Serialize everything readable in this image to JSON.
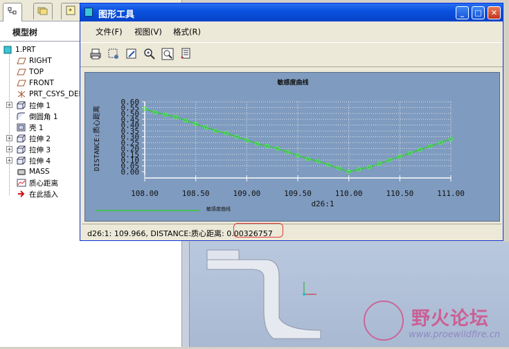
{
  "model_tree": {
    "title": "模型树",
    "items": [
      {
        "label": "1.PRT"
      },
      {
        "label": "RIGHT"
      },
      {
        "label": "TOP"
      },
      {
        "label": "FRONT"
      },
      {
        "label": "PRT_CSYS_DEF"
      },
      {
        "label": "拉伸 1"
      },
      {
        "label": "倒圆角 1"
      },
      {
        "label": "壳 1"
      },
      {
        "label": "拉伸 2"
      },
      {
        "label": "拉伸 3"
      },
      {
        "label": "拉伸 4"
      },
      {
        "label": "MASS"
      },
      {
        "label": "质心距离"
      },
      {
        "label": "在此插入"
      }
    ]
  },
  "window": {
    "title": "图形工具",
    "menu": [
      "文件(F)",
      "视图(V)",
      "格式(R)"
    ],
    "status_text": "d26:1: 109.966, DISTANCE:质心距离: 0.00326757"
  },
  "watermark": {
    "title": "野火论坛",
    "url": "www.proewildfire.cn"
  },
  "colors": {
    "titlebar": "#0a52e0",
    "plot_bg": "#7f9bbf",
    "series": "#33cc33",
    "highlight": "#e23c3c"
  },
  "chart_data": {
    "type": "line",
    "title": "敏感度曲线",
    "xlabel": "d26:1",
    "ylabel": "DISTANCE:质心距离",
    "xlim": [
      108.0,
      111.0
    ],
    "ylim": [
      0.0,
      0.6
    ],
    "xticks": [
      "108.00",
      "108.50",
      "109.00",
      "109.50",
      "110.00",
      "110.50",
      "111.00"
    ],
    "yticks": [
      "0.00",
      "0.05",
      "0.10",
      "0.15",
      "0.20",
      "0.25",
      "0.30",
      "0.35",
      "0.40",
      "0.45",
      "0.50",
      "0.55",
      "0.60"
    ],
    "grid": true,
    "legend": [
      {
        "name": "敏感度曲线",
        "color": "#33cc33"
      }
    ],
    "series": [
      {
        "name": "敏感度曲线",
        "x": [
          108.0,
          108.1,
          108.2,
          108.3,
          108.4,
          108.5,
          108.6,
          108.7,
          108.8,
          108.9,
          109.0,
          109.1,
          109.2,
          109.3,
          109.4,
          109.5,
          109.6,
          109.7,
          109.8,
          109.9,
          110.0,
          110.1,
          110.2,
          110.3,
          110.4,
          110.5,
          110.6,
          110.7,
          110.8,
          110.9,
          111.0
        ],
        "y": [
          0.54,
          0.51,
          0.49,
          0.47,
          0.44,
          0.41,
          0.38,
          0.35,
          0.33,
          0.3,
          0.27,
          0.24,
          0.22,
          0.2,
          0.17,
          0.14,
          0.11,
          0.09,
          0.06,
          0.03,
          0.0,
          0.02,
          0.04,
          0.07,
          0.1,
          0.13,
          0.16,
          0.19,
          0.22,
          0.25,
          0.28
        ]
      }
    ]
  }
}
